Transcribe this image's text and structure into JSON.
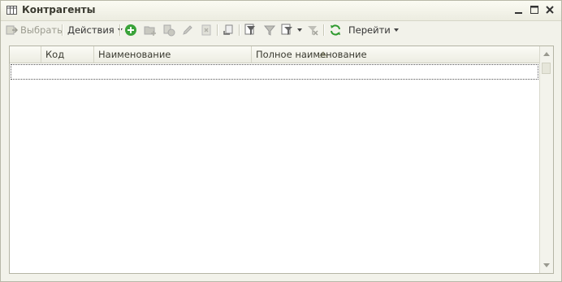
{
  "window": {
    "title": "Контрагенты"
  },
  "toolbar": {
    "select_label": "Выбрать",
    "actions_label": "Действия",
    "goto_label": "Перейти"
  },
  "table": {
    "columns": [
      "Код",
      "Наименование",
      "Полное наименование"
    ],
    "rows": []
  },
  "colors": {
    "accent_green": "#3aa33a",
    "window_bg": "#f2f2ea"
  }
}
